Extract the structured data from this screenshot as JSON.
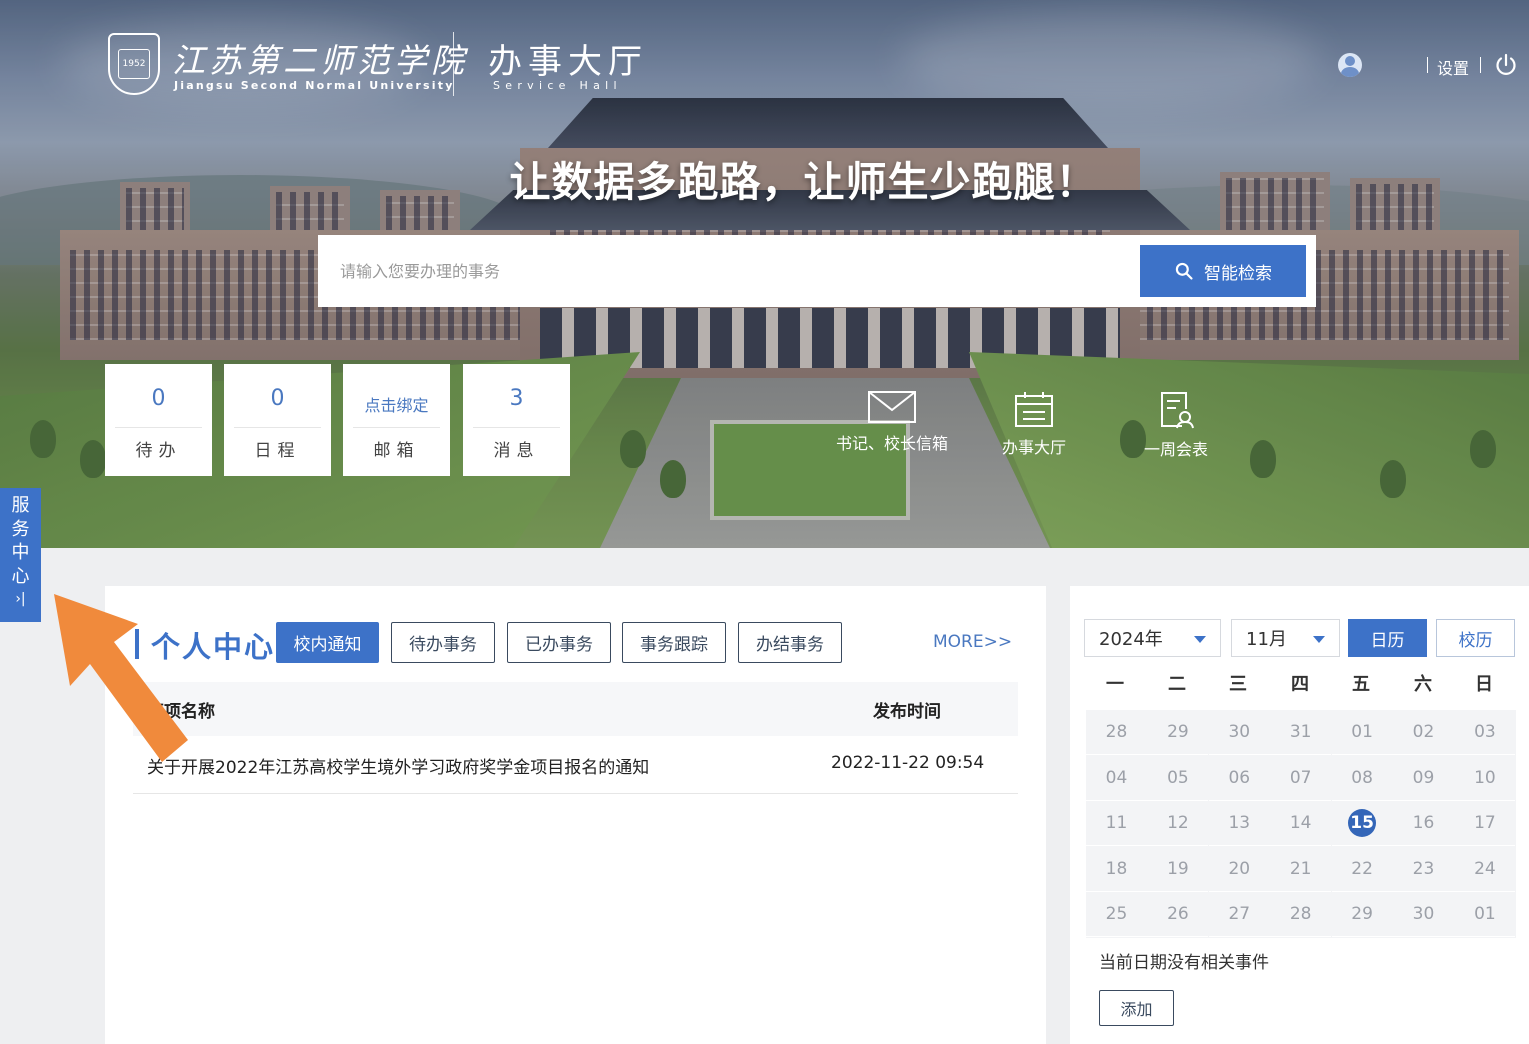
{
  "header": {
    "school_name": "江苏第二师范学院",
    "school_name_en": "Jiangsu Second Normal University",
    "hall_title": "办事大厅",
    "hall_title_en": "Service Hall",
    "settings_label": "设置",
    "user_name": ""
  },
  "hero": {
    "slogan": "让数据多跑路，让师生少跑腿！",
    "search_placeholder": "请输入您要办理的事务",
    "search_button": "智能检索"
  },
  "stats": [
    {
      "value": "0",
      "label": "待办"
    },
    {
      "value": "0",
      "label": "日程"
    },
    {
      "value": "点击绑定",
      "label": "邮箱"
    },
    {
      "value": "3",
      "label": "消息"
    }
  ],
  "quick_links": [
    {
      "label": "书记、校长信箱",
      "icon": "mail-icon"
    },
    {
      "label": "办事大厅",
      "icon": "hall-icon"
    },
    {
      "label": "一周会表",
      "icon": "schedule-doc-icon"
    }
  ],
  "service_tab": {
    "chars": [
      "服",
      "务",
      "中",
      "心"
    ],
    "arrow": "›|"
  },
  "personal_center": {
    "title": "个人中心",
    "tabs": [
      "校内通知",
      "待办事务",
      "已办事务",
      "事务跟踪",
      "办结事务"
    ],
    "active_tab": 0,
    "more_label": "MORE>>",
    "columns": [
      "事项名称",
      "发布时间"
    ],
    "rows": [
      {
        "name": "关于开展2022年江苏高校学生境外学习政府奖学金项目报名的通知",
        "time": "2022-11-22 09:54"
      }
    ]
  },
  "calendar": {
    "year_label": "2024年",
    "month_label": "11月",
    "btn_calendar": "日历",
    "btn_school": "校历",
    "weekdays": [
      "一",
      "二",
      "三",
      "四",
      "五",
      "六",
      "日"
    ],
    "weeks": [
      [
        "28",
        "29",
        "30",
        "31",
        "01",
        "02",
        "03"
      ],
      [
        "04",
        "05",
        "06",
        "07",
        "08",
        "09",
        "10"
      ],
      [
        "11",
        "12",
        "13",
        "14",
        "15",
        "16",
        "17"
      ],
      [
        "18",
        "19",
        "20",
        "21",
        "22",
        "23",
        "24"
      ],
      [
        "25",
        "26",
        "27",
        "28",
        "29",
        "30",
        "01"
      ]
    ],
    "today": "15",
    "no_event_text": "当前日期没有相关事件",
    "add_button": "添加"
  },
  "colors": {
    "accent": "#3d72c8",
    "arrow": "#f08a3c",
    "muted_date": "#9ca0a8"
  }
}
